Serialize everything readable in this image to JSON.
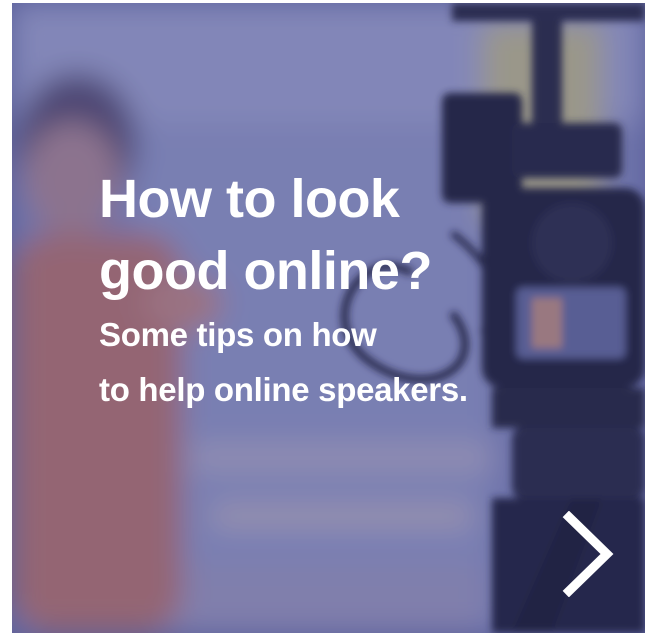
{
  "hero": {
    "headline_line1": "How to look",
    "headline_line2": "good online?",
    "subline_line1": "Some tips on how",
    "subline_line2": "to help online speakers."
  },
  "icons": {
    "next": "chevron-right-icon"
  },
  "colors": {
    "overlay": "#3a3f8c",
    "text": "#ffffff"
  }
}
